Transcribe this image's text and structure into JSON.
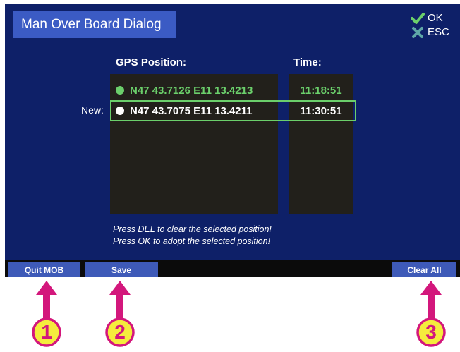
{
  "dialog": {
    "title": "Man Over Board Dialog",
    "ok_label": "OK",
    "esc_label": "ESC"
  },
  "headers": {
    "gps": "GPS Position:",
    "time": "Time:"
  },
  "positions": [
    {
      "label": "",
      "position": "N47 43.7126 E11 13.4213",
      "time": "11:18:51",
      "color": "#6bcf6b",
      "selected": false
    },
    {
      "label": "New:",
      "position": "N47 43.7075 E11 13.4211",
      "time": "11:30:51",
      "color": "#ffffff",
      "selected": true
    }
  ],
  "hints": [
    "Press DEL to clear the selected position!",
    "Press OK to adopt the selected position!"
  ],
  "buttons": {
    "quit": "Quit MOB",
    "save": "Save",
    "clear_all": "Clear All"
  },
  "callouts": [
    "1",
    "2",
    "3"
  ],
  "colors": {
    "background": "#0e2068",
    "title_bg": "#3b5bc4",
    "button_bg": "#3e5ab8",
    "selected_border": "#6bcf6b",
    "list_bg": "#22201b",
    "callout_fill": "#f5ec3d",
    "callout_stroke": "#d3177c"
  }
}
